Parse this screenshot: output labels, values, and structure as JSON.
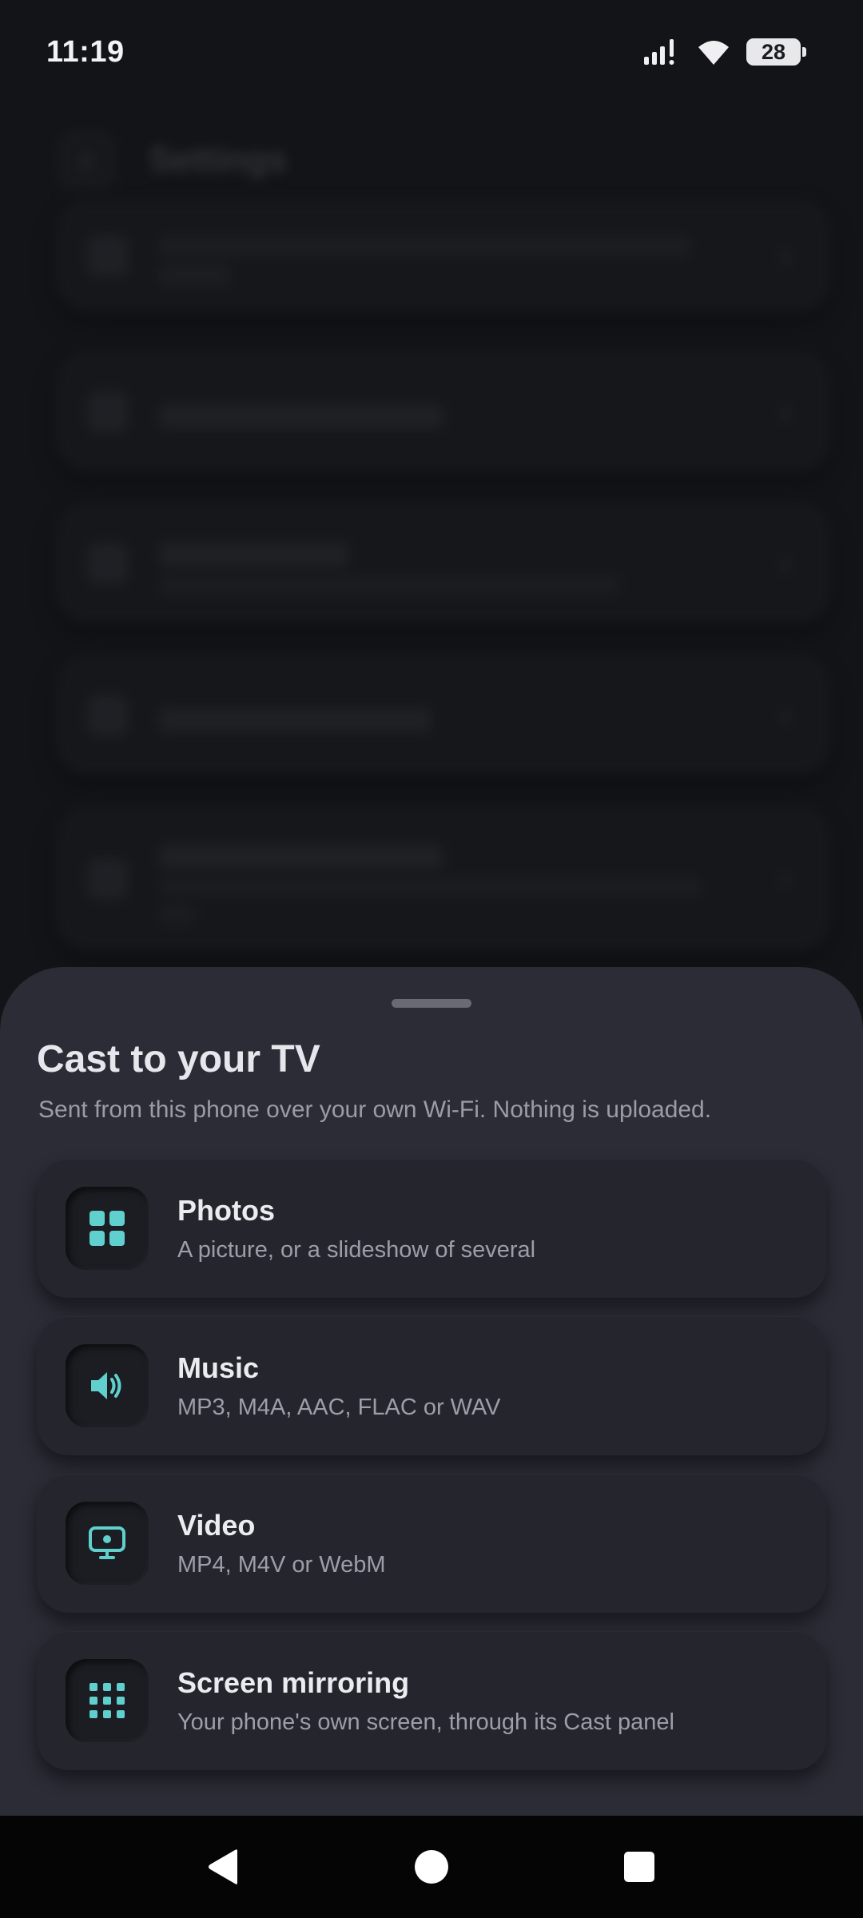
{
  "status_bar": {
    "time": "11:19",
    "battery_level": "28",
    "icons": [
      "signal-icon",
      "wifi-icon",
      "battery-icon"
    ]
  },
  "background": {
    "title": "Settings"
  },
  "sheet": {
    "title": "Cast to your TV",
    "subtitle": "Sent from this phone over your own Wi-Fi. Nothing is uploaded.",
    "options": [
      {
        "title": "Photos",
        "description": "A picture, or a slideshow of several",
        "icon": "grid-icon"
      },
      {
        "title": "Music",
        "description": "MP3, M4A, AAC, FLAC or WAV",
        "icon": "speaker-icon"
      },
      {
        "title": "Video",
        "description": "MP4, M4V or WebM",
        "icon": "screen-play-icon"
      },
      {
        "title": "Screen mirroring",
        "description": "Your phone's own screen, through its Cast panel",
        "icon": "dots-grid-icon"
      }
    ]
  },
  "colors": {
    "accent": "#5fd0cd",
    "sheet_bg": "#2b2c35",
    "card_bg": "#25262d"
  },
  "nav_bar": {
    "icons": [
      "back-icon",
      "home-icon",
      "recents-icon"
    ]
  }
}
